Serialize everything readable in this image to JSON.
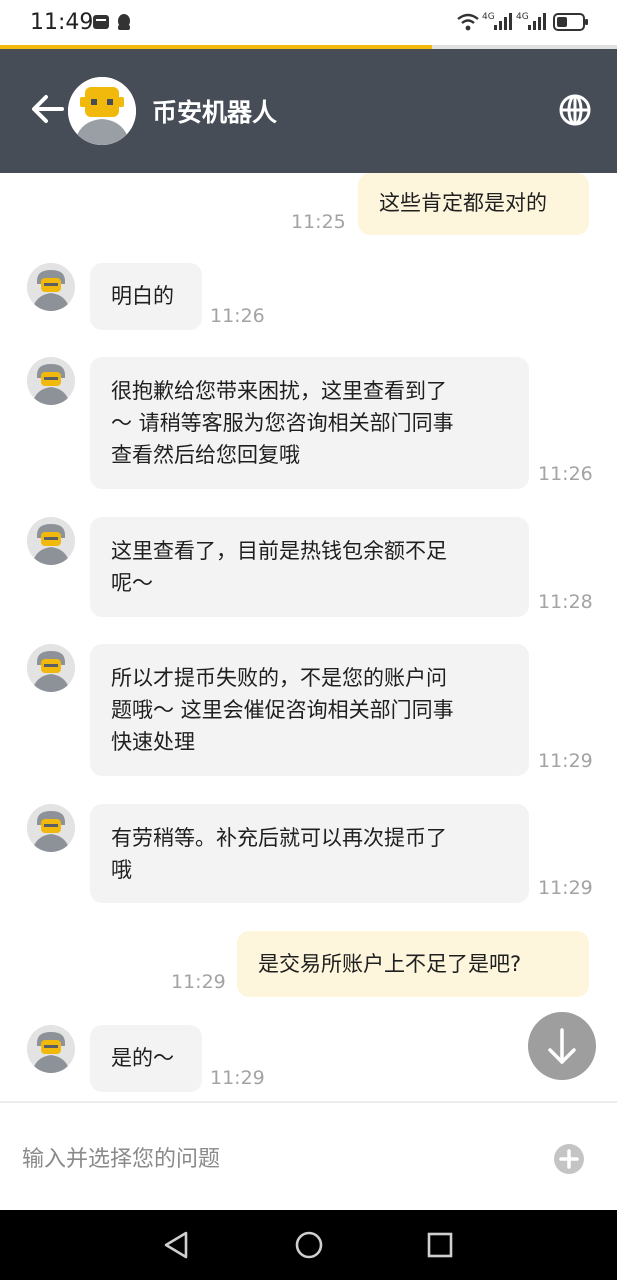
{
  "status_bar": {
    "time": "11:49",
    "network_label": "4G",
    "battery_icon": "battery-icon"
  },
  "header": {
    "title": "币安机器人",
    "back_icon": "back-arrow-icon",
    "language_icon": "globe-icon",
    "accent_color": "#f0b90b",
    "background_color": "#474d57"
  },
  "page_load_progress": 0.7,
  "messages": [
    {
      "sender": "me",
      "text": "这些肯定都是对的",
      "time": "11:25"
    },
    {
      "sender": "bot",
      "text": "明白的",
      "time": "11:26"
    },
    {
      "sender": "bot",
      "lines": [
        "很抱歉给您带来困扰，这里查看到了",
        "～ 请稍等客服为您咨询相关部门同事",
        "查看然后给您回复哦"
      ],
      "time": "11:26"
    },
    {
      "sender": "bot",
      "lines": [
        "这里查看了，目前是热钱包余额不足",
        "呢～"
      ],
      "time": "11:28"
    },
    {
      "sender": "bot",
      "lines": [
        "所以才提币失败的，不是您的账户问",
        "题哦～ 这里会催促咨询相关部门同事",
        "快速处理"
      ],
      "time": "11:29"
    },
    {
      "sender": "bot",
      "lines": [
        "有劳稍等。补充后就可以再次提币了",
        "哦"
      ],
      "time": "11:29"
    },
    {
      "sender": "me",
      "text": "是交易所账户上不足了是吧?",
      "time": "11:29"
    },
    {
      "sender": "bot",
      "text": "是的～",
      "time": "11:29"
    }
  ],
  "input": {
    "placeholder": "输入并选择您的问题",
    "add_icon": "plus-circle-icon"
  },
  "scroll_down_icon": "arrow-down-icon",
  "nav_bar": {
    "back_icon": "triangle-back-icon",
    "home_icon": "circle-home-icon",
    "recents_icon": "square-recents-icon"
  }
}
